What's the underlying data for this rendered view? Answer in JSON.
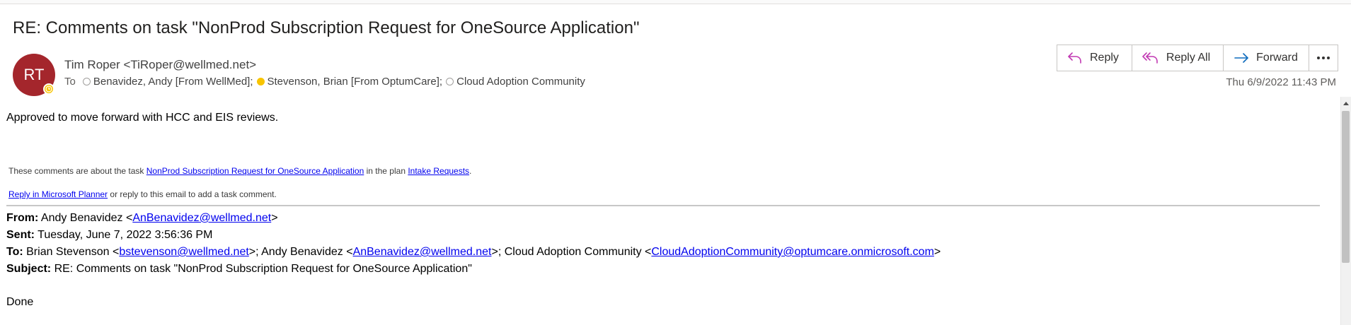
{
  "email": {
    "subject": "RE: Comments on task \"NonProd Subscription Request for OneSource Application\"",
    "avatar_initials": "RT",
    "sender": "Tim Roper <TiRoper@wellmed.net>",
    "to_label": "To",
    "recipients": [
      {
        "name": "Benavidez, Andy  [From WellMed];",
        "status": "offline"
      },
      {
        "name": "Stevenson, Brian [From OptumCare];",
        "status": "away"
      },
      {
        "name": "Cloud Adoption Community",
        "status": "offline"
      }
    ],
    "timestamp": "Thu 6/9/2022 11:43 PM"
  },
  "actions": {
    "reply": "Reply",
    "reply_all": "Reply All",
    "forward": "Forward"
  },
  "body": {
    "main": "Approved to move forward with HCC and EIS reviews.",
    "comments_prefix": "These comments are about the task ",
    "task_link": "NonProd Subscription Request for OneSource Application",
    "comments_mid": " in the plan ",
    "plan_link": "Intake Requests",
    "comments_suffix": ".",
    "planner_link": "Reply in Microsoft Planner",
    "reply_suffix": " or reply to this email to add a task comment."
  },
  "quoted": {
    "from_label": "From:",
    "from_name": " Andy Benavidez <",
    "from_email": "AnBenavidez@wellmed.net",
    "from_close": ">",
    "sent_label": "Sent:",
    "sent_value": " Tuesday, June 7, 2022 3:56:36 PM",
    "to_label": "To:",
    "to_p1": " Brian Stevenson <",
    "to_email1": "bstevenson@wellmed.net",
    "to_p2": ">; Andy Benavidez <",
    "to_email2": "AnBenavidez@wellmed.net",
    "to_p3": ">; Cloud Adoption Community <",
    "to_email3": "CloudAdoptionCommunity@optumcare.onmicrosoft.com",
    "to_p4": ">",
    "subject_label": "Subject:",
    "subject_value": " RE: Comments on task \"NonProd Subscription Request for OneSource Application\"",
    "body": "Done"
  },
  "colors": {
    "avatar_bg": "#a4262c",
    "link": "#0000ee",
    "reply_icon": "#c239b3",
    "forward_icon": "#0f6cbd",
    "away_status": "#f8c400"
  },
  "icons": [
    "reply-icon",
    "reply-all-icon",
    "forward-icon",
    "more-icon",
    "clock-icon"
  ]
}
